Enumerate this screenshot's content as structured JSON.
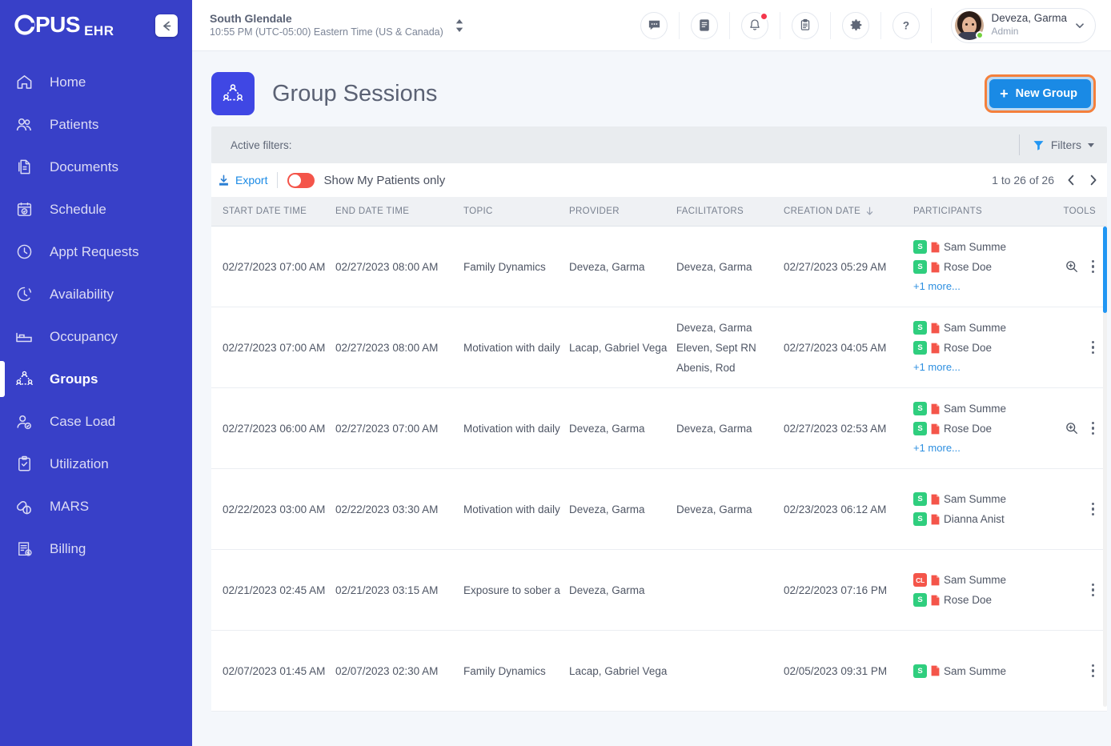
{
  "brand": {
    "name_o": "O",
    "name_pus": "PUS",
    "suffix": "EHR",
    "collapse_icon": "arrow-left-icon"
  },
  "sidebar": {
    "items": [
      {
        "label": "Home",
        "icon": "home-icon",
        "active": false
      },
      {
        "label": "Patients",
        "icon": "users-icon",
        "active": false
      },
      {
        "label": "Documents",
        "icon": "documents-icon",
        "active": false
      },
      {
        "label": "Schedule",
        "icon": "calendar-check-icon",
        "active": false
      },
      {
        "label": "Appt Requests",
        "icon": "clock-icon",
        "active": false
      },
      {
        "label": "Availability",
        "icon": "clock-dashed-icon",
        "active": false
      },
      {
        "label": "Occupancy",
        "icon": "bed-icon",
        "active": false
      },
      {
        "label": "Groups",
        "icon": "group-network-icon",
        "active": true
      },
      {
        "label": "Case Load",
        "icon": "user-check-icon",
        "active": false
      },
      {
        "label": "Utilization",
        "icon": "clipboard-check-icon",
        "active": false
      },
      {
        "label": "MARS",
        "icon": "pills-icon",
        "active": false
      },
      {
        "label": "Billing",
        "icon": "invoice-dollar-icon",
        "active": false
      }
    ]
  },
  "topbar": {
    "facility_name": "South Glendale",
    "facility_timezone": "10:55 PM (UTC-05:00) Eastern Time (US & Canada)",
    "facility_switch_icon": "up-down-arrows-icon",
    "icons": [
      {
        "name": "chat-icon",
        "badge": false
      },
      {
        "name": "book-icon",
        "badge": false
      },
      {
        "name": "bell-icon",
        "badge": true
      },
      {
        "name": "clipboard-icon",
        "badge": false
      },
      {
        "name": "gear-icon",
        "badge": false
      },
      {
        "name": "help-icon",
        "badge": false
      }
    ],
    "user": {
      "name": "Deveza, Garma",
      "role": "Admin",
      "status": "online",
      "chevron": "chevron-down-icon"
    }
  },
  "page": {
    "icon": "group-network-icon",
    "title": "Group Sessions",
    "new_group_label": "New Group",
    "new_group_plus": "+",
    "highlight_color": "#f4803c",
    "accent_color": "#1a8ae5"
  },
  "filters": {
    "active_filters_label": "Active filters:",
    "filters_label": "Filters",
    "filter_icon": "funnel-icon",
    "caret_icon": "caret-down-icon"
  },
  "toolrow": {
    "export_label": "Export",
    "export_icon": "download-icon",
    "toggle_label": "Show My Patients only",
    "toggle_on": false,
    "toggle_color": "#f4554a",
    "pager_text": "1 to 26 of 26",
    "prev_icon": "chevron-left-icon",
    "next_icon": "chevron-right-icon"
  },
  "table": {
    "columns": [
      {
        "label": "START DATE TIME",
        "sorted": false
      },
      {
        "label": "END DATE TIME",
        "sorted": false
      },
      {
        "label": "TOPIC",
        "sorted": false
      },
      {
        "label": "PROVIDER",
        "sorted": false
      },
      {
        "label": "FACILITATORS",
        "sorted": false
      },
      {
        "label": "CREATION DATE",
        "sorted": true,
        "sort_icon": "arrow-down-icon"
      },
      {
        "label": "PARTICIPANTS",
        "sorted": false
      },
      {
        "label": "TOOLS",
        "sorted": false
      }
    ],
    "rows": [
      {
        "start": "02/27/2023 07:00 AM",
        "end": "02/27/2023 08:00 AM",
        "topic": "Family Dynamics",
        "provider": "Deveza, Garma",
        "facilitators": [
          "Deveza, Garma"
        ],
        "creation": "02/27/2023 05:29 AM",
        "participants": [
          {
            "badge": "S",
            "badge_type": "s",
            "name": "Sam Summe"
          },
          {
            "badge": "S",
            "badge_type": "s",
            "name": "Rose Doe"
          }
        ],
        "more_label": "+1 more...",
        "has_magnifier": true
      },
      {
        "start": "02/27/2023 07:00 AM",
        "end": "02/27/2023 08:00 AM",
        "topic": "Motivation with daily",
        "provider": "Lacap, Gabriel Vega",
        "facilitators": [
          "Deveza, Garma",
          "Eleven, Sept RN",
          "Abenis, Rod"
        ],
        "creation": "02/27/2023 04:05 AM",
        "participants": [
          {
            "badge": "S",
            "badge_type": "s",
            "name": "Sam Summe"
          },
          {
            "badge": "S",
            "badge_type": "s",
            "name": "Rose Doe"
          }
        ],
        "more_label": "+1 more...",
        "has_magnifier": false
      },
      {
        "start": "02/27/2023 06:00 AM",
        "end": "02/27/2023 07:00 AM",
        "topic": "Motivation with daily",
        "provider": "Deveza, Garma",
        "facilitators": [
          "Deveza, Garma"
        ],
        "creation": "02/27/2023 02:53 AM",
        "participants": [
          {
            "badge": "S",
            "badge_type": "s",
            "name": "Sam Summe"
          },
          {
            "badge": "S",
            "badge_type": "s",
            "name": "Rose Doe"
          }
        ],
        "more_label": "+1 more...",
        "has_magnifier": true
      },
      {
        "start": "02/22/2023 03:00 AM",
        "end": "02/22/2023 03:30 AM",
        "topic": "Motivation with daily",
        "provider": "Deveza, Garma",
        "facilitators": [
          "Deveza, Garma"
        ],
        "creation": "02/23/2023 06:12 AM",
        "participants": [
          {
            "badge": "S",
            "badge_type": "s",
            "name": "Sam Summe"
          },
          {
            "badge": "S",
            "badge_type": "s",
            "name": "Dianna Anist"
          }
        ],
        "more_label": "",
        "has_magnifier": false
      },
      {
        "start": "02/21/2023 02:45 AM",
        "end": "02/21/2023 03:15 AM",
        "topic": "Exposure to sober a",
        "provider": "Deveza, Garma",
        "facilitators": [],
        "creation": "02/22/2023 07:16 PM",
        "participants": [
          {
            "badge": "CL",
            "badge_type": "cl",
            "name": "Sam Summe"
          },
          {
            "badge": "S",
            "badge_type": "s",
            "name": "Rose Doe"
          }
        ],
        "more_label": "",
        "has_magnifier": false
      },
      {
        "start": "02/07/2023 01:45 AM",
        "end": "02/07/2023 02:30 AM",
        "topic": "Family Dynamics",
        "provider": "Lacap, Gabriel Vega",
        "facilitators": [],
        "creation": "02/05/2023 09:31 PM",
        "participants": [
          {
            "badge": "S",
            "badge_type": "s",
            "name": "Sam Summe"
          }
        ],
        "more_label": "",
        "has_magnifier": false
      }
    ]
  }
}
